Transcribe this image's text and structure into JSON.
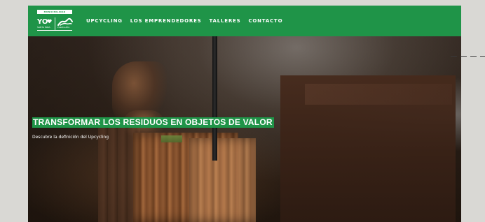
{
  "header": {
    "logo_top": "MUNICIPALIDAD",
    "logo_left_text": "YO",
    "logo_left_sub": "SANTA ELBA",
    "logo_right_sub": "Puente Alto"
  },
  "nav": {
    "items": [
      {
        "label": "UPCYCLING"
      },
      {
        "label": "LOS EMPRENDEDORES"
      },
      {
        "label": "TALLERES"
      },
      {
        "label": "CONTACTO"
      }
    ]
  },
  "hero": {
    "title": "TRANSFORMAR LOS RESIDUOS EN OBJETOS DE VALOR",
    "subtitle": "Descubre la definición del Upcycling"
  },
  "colors": {
    "primary": "#1f9448",
    "background": "#d9d8d4",
    "text": "#ffffff"
  }
}
